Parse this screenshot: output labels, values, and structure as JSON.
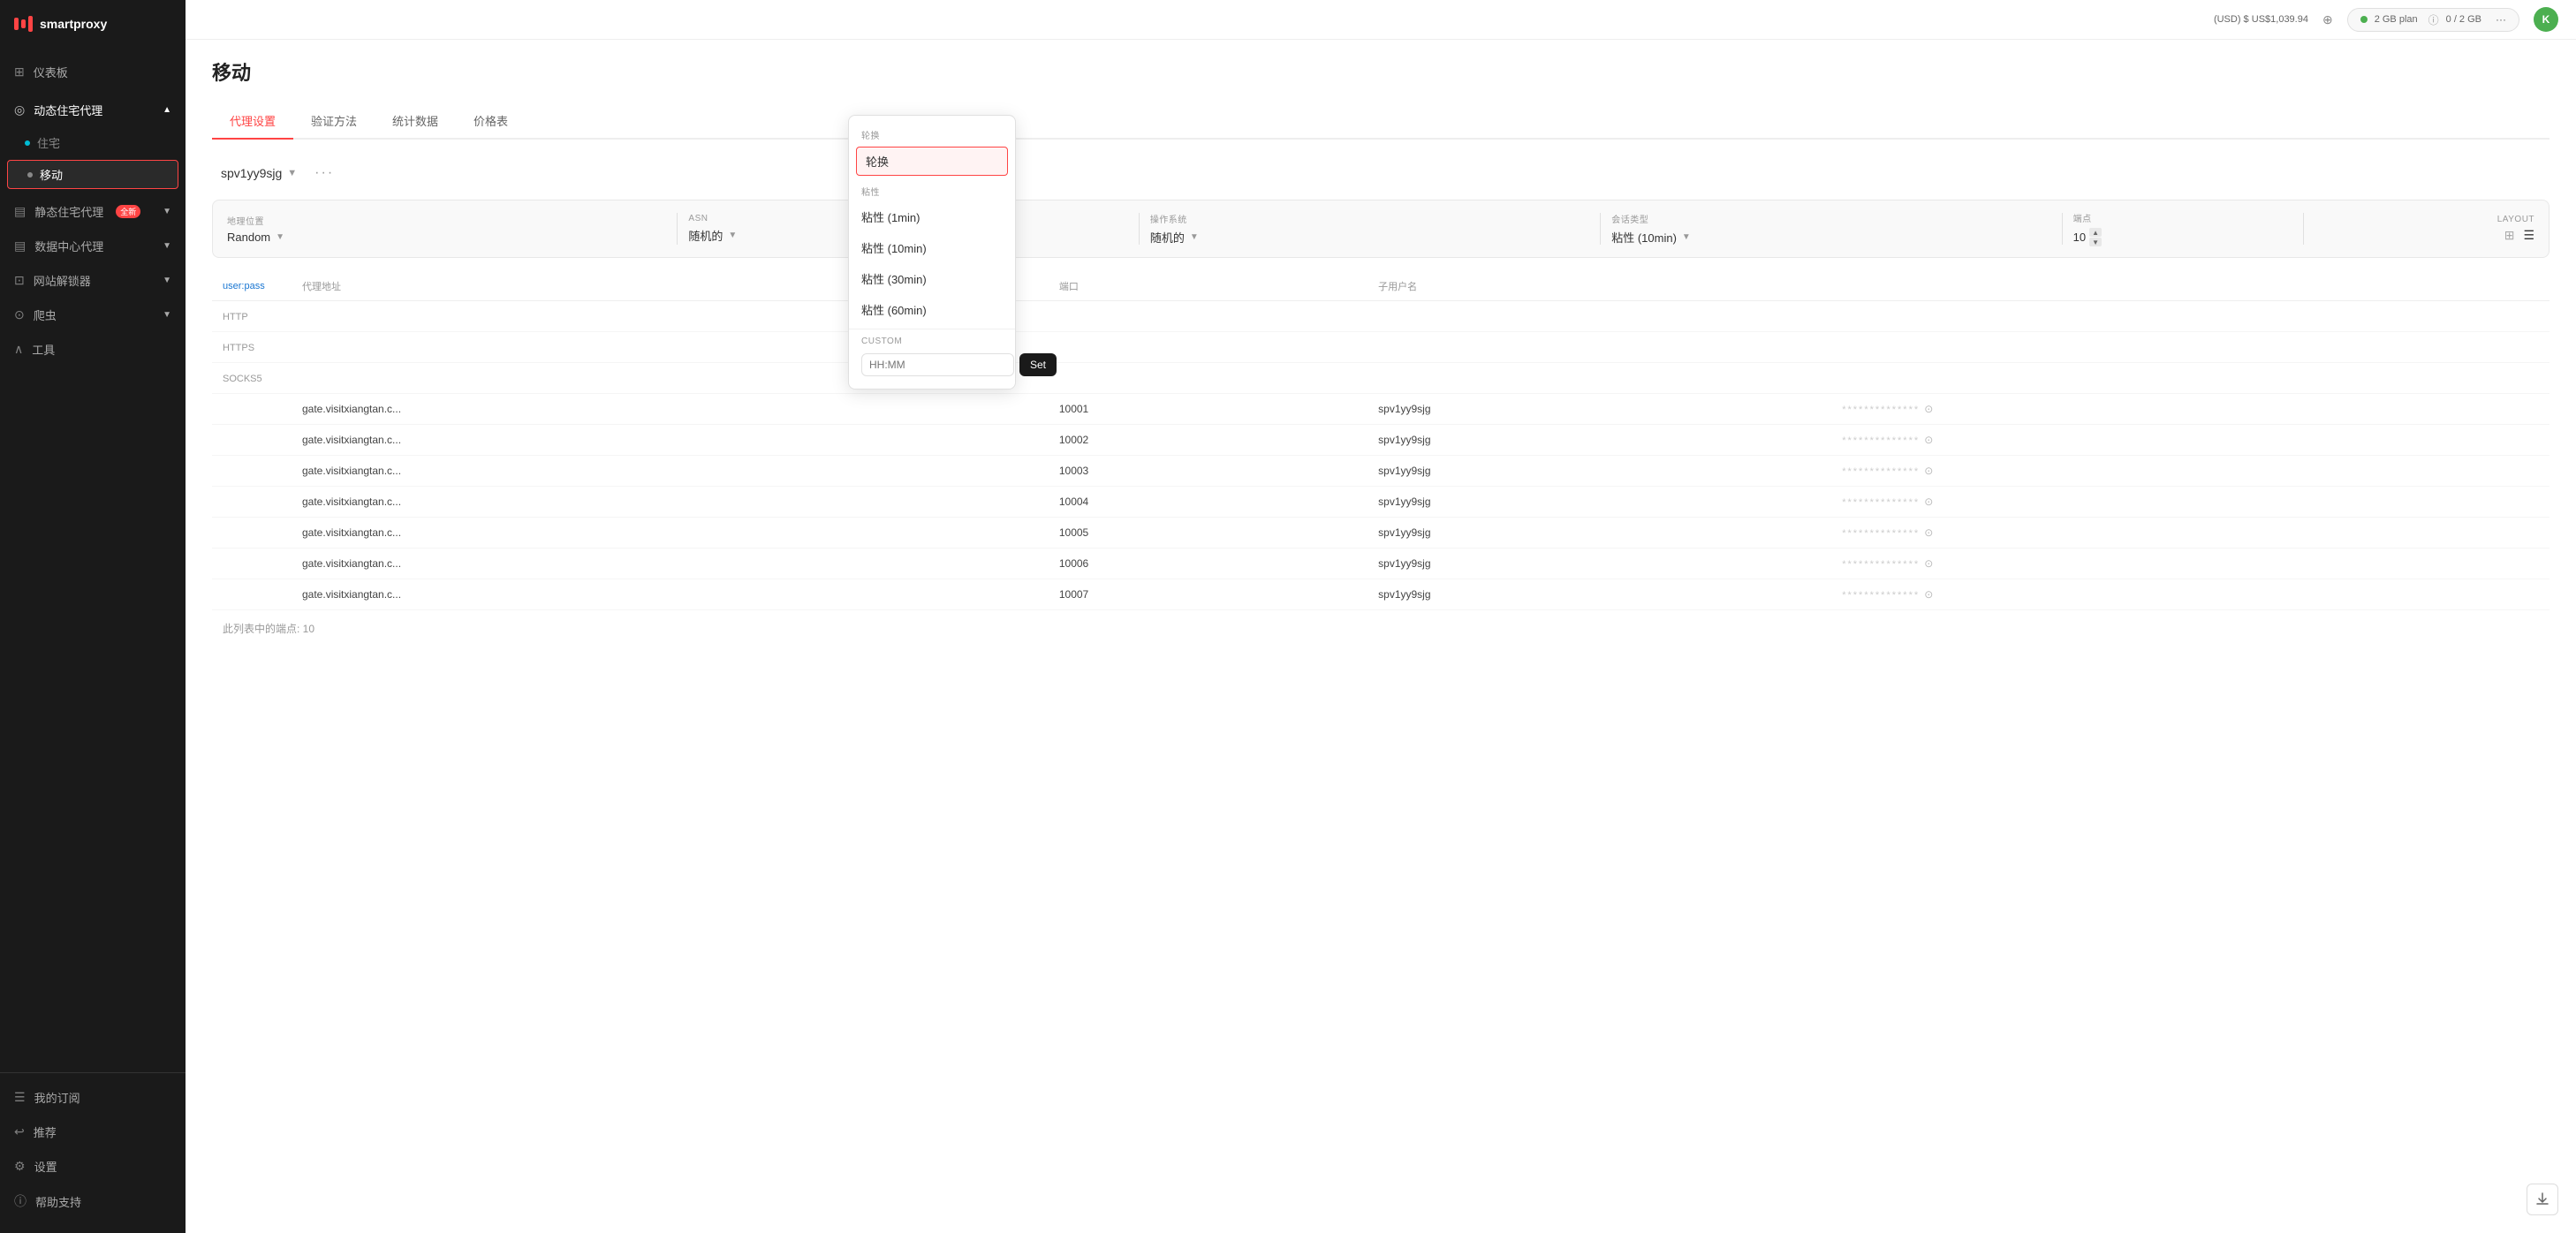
{
  "app": {
    "name": "smartproxy"
  },
  "header": {
    "balance": "(USD) $",
    "balance_amount": "US$1,039.94",
    "plan_name": "2 GB plan",
    "plan_usage": "0 / 2 GB"
  },
  "sidebar": {
    "logo": "smartproxy",
    "menu_items": [
      {
        "id": "dashboard",
        "icon": "⊞",
        "label": "仪表板",
        "active": false
      },
      {
        "id": "dynamic-residential",
        "icon": "◎",
        "label": "动态住宅代理",
        "expanded": true,
        "sub_items": [
          {
            "id": "residential",
            "label": "住宅",
            "active": false
          },
          {
            "id": "mobile",
            "label": "移动",
            "active": true
          }
        ]
      },
      {
        "id": "static-residential",
        "icon": "▤",
        "label": "静态住宅代理",
        "badge": "全新",
        "expanded": false
      },
      {
        "id": "datacenter",
        "icon": "▤",
        "label": "数据中心代理",
        "expanded": false
      },
      {
        "id": "web-unlocker",
        "icon": "⊡",
        "label": "网站解锁器",
        "expanded": false
      },
      {
        "id": "scraper",
        "icon": "⊙",
        "label": "爬虫",
        "expanded": false
      },
      {
        "id": "tools",
        "icon": "∧",
        "label": "工具",
        "expanded": false
      }
    ],
    "bottom_items": [
      {
        "id": "subscription",
        "icon": "☰",
        "label": "我的订阅"
      },
      {
        "id": "referral",
        "icon": "↩",
        "label": "推荐"
      },
      {
        "id": "settings",
        "icon": "⚙",
        "label": "设置"
      },
      {
        "id": "help",
        "icon": "ⓘ",
        "label": "帮助支持"
      }
    ]
  },
  "page": {
    "title": "移动",
    "tabs": [
      {
        "id": "proxy-settings",
        "label": "代理设置",
        "active": true
      },
      {
        "id": "auth-method",
        "label": "验证方法",
        "active": false
      },
      {
        "id": "statistics",
        "label": "统计数据",
        "active": false
      },
      {
        "id": "pricing",
        "label": "价格表",
        "active": false
      }
    ],
    "session_name": "spv1yy9sjg",
    "filters": {
      "location": {
        "label": "地理位置",
        "value": "Random"
      },
      "asn": {
        "label": "ASN",
        "value": "随机的"
      },
      "os": {
        "label": "操作系统",
        "value": "随机的"
      },
      "session_type": {
        "label": "会话类型",
        "value": "粘性 (10min)"
      },
      "endpoint": {
        "label": "端点",
        "value": "10"
      },
      "layout_label": "LAYOUT"
    },
    "columns": [
      {
        "key": "type",
        "label": ""
      },
      {
        "key": "proxy_address",
        "label": "代理地址"
      },
      {
        "key": "port",
        "label": "端口"
      },
      {
        "key": "sub_username",
        "label": "子用户名"
      },
      {
        "key": "password",
        "label": ""
      }
    ],
    "format_tabs": [
      "user:pass"
    ],
    "protocol_tabs": [
      "HTTP",
      "HTTPS",
      "SOCKS5"
    ],
    "rows": [
      {
        "proxy": "gate.visitxiangtan.c...",
        "port": "10001",
        "username": "spv1yy9sjg",
        "password": "**************"
      },
      {
        "proxy": "gate.visitxiangtan.c...",
        "port": "10002",
        "username": "spv1yy9sjg",
        "password": "**************"
      },
      {
        "proxy": "gate.visitxiangtan.c...",
        "port": "10003",
        "username": "spv1yy9sjg",
        "password": "**************"
      },
      {
        "proxy": "gate.visitxiangtan.c...",
        "port": "10004",
        "username": "spv1yy9sjg",
        "password": "**************"
      },
      {
        "proxy": "gate.visitxiangtan.c...",
        "port": "10005",
        "username": "spv1yy9sjg",
        "password": "**************"
      },
      {
        "proxy": "gate.visitxiangtan.c...",
        "port": "10006",
        "username": "spv1yy9sjg",
        "password": "**************"
      },
      {
        "proxy": "gate.visitxiangtan.c...",
        "port": "10007",
        "username": "spv1yy9sjg",
        "password": "**************"
      }
    ],
    "table_footer": "此列表中的端点: 10"
  },
  "dropdown": {
    "rotate_section_label": "轮换",
    "rotate_item": "轮换",
    "sticky_section_label": "粘性",
    "sticky_items": [
      {
        "label": "粘性 (1min)"
      },
      {
        "label": "粘性 (10min)"
      },
      {
        "label": "粘性 (30min)"
      },
      {
        "label": "粘性 (60min)"
      }
    ],
    "custom_label": "CUSTOM",
    "custom_placeholder": "HH:MM",
    "set_button": "Set"
  }
}
